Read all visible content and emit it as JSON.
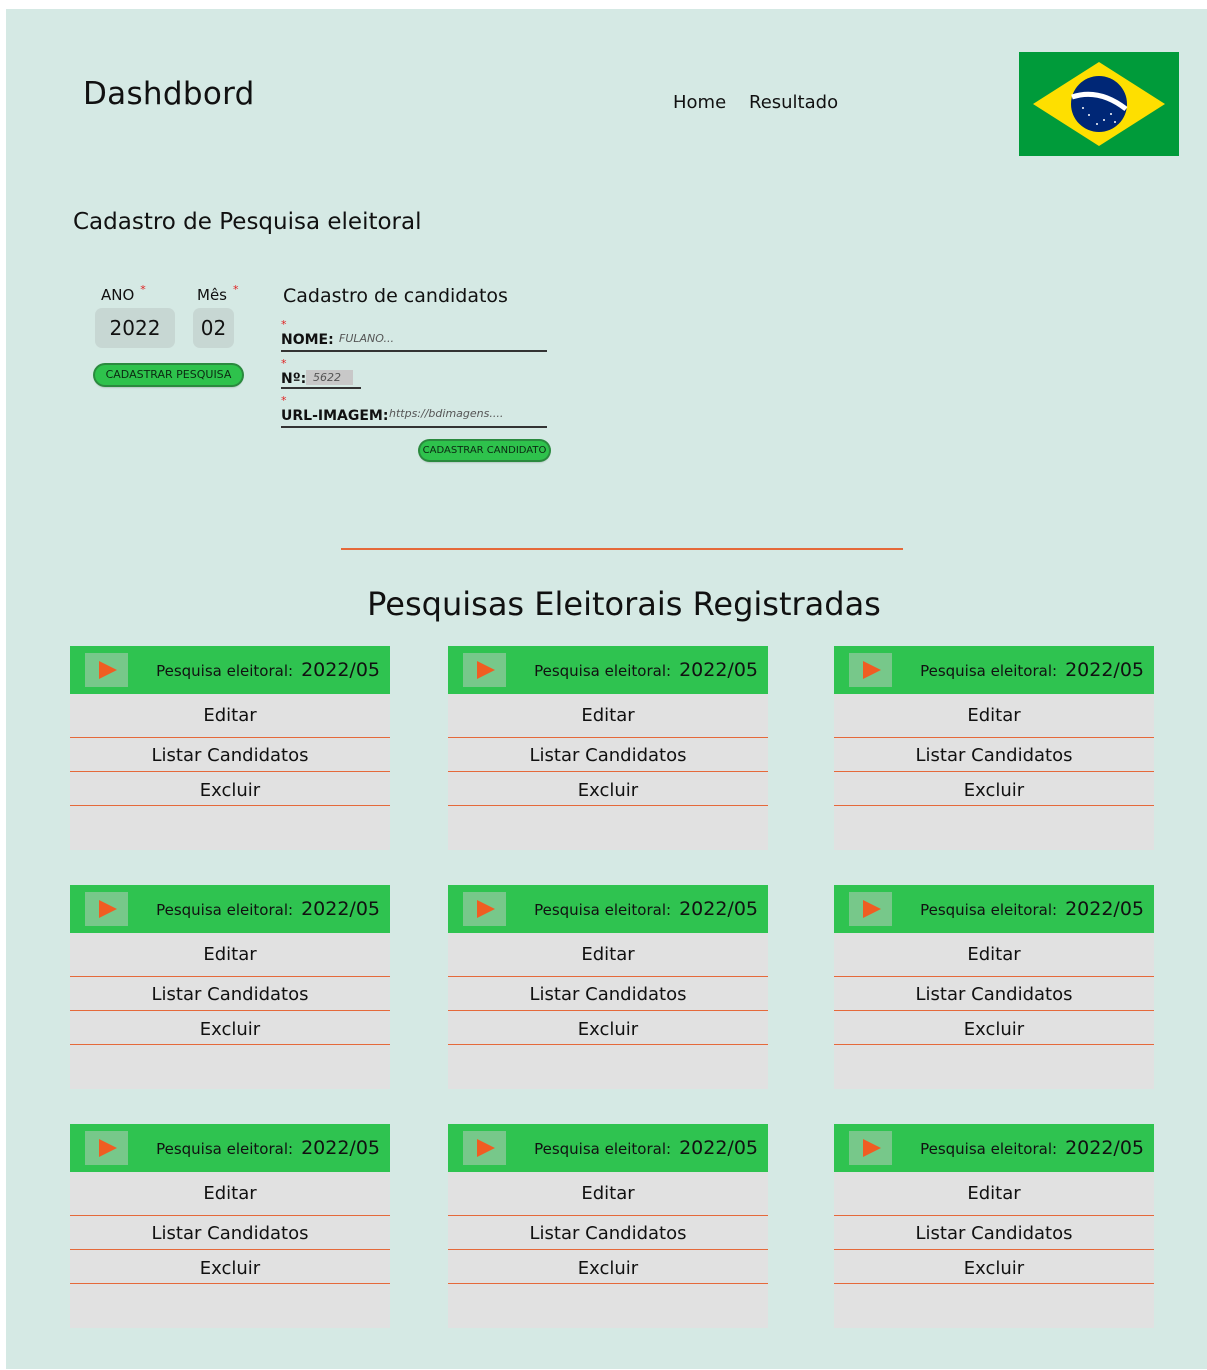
{
  "header": {
    "title": "Dashdbord",
    "nav": [
      "Home",
      "Resultado"
    ]
  },
  "form": {
    "title": "Cadastro de Pesquisa eleitoral",
    "ano_label": "ANO",
    "ano_value": "2022",
    "mes_label": "Mês",
    "mes_value": "02",
    "required_mark": "*",
    "submit_label": "CADASTRAR PESQUISA"
  },
  "candidate_form": {
    "title": "Cadastro de candidatos",
    "nome_label": "NOME:",
    "nome_placeholder": "FULANO...",
    "numero_label": "Nº:",
    "numero_value": "5622",
    "url_label": "URL-IMAGEM:",
    "url_placeholder": "https://bdimagens....",
    "submit_label": "CADASTRAR CANDIDATO"
  },
  "list": {
    "title": "Pesquisas Eleitorais Registradas",
    "cards": [
      {
        "label": "Pesquisa eleitoral:",
        "value": "2022/05",
        "actions": [
          "Editar",
          "Listar Candidatos",
          "Excluir"
        ]
      },
      {
        "label": "Pesquisa eleitoral:",
        "value": "2022/05",
        "actions": [
          "Editar",
          "Listar Candidatos",
          "Excluir"
        ]
      },
      {
        "label": "Pesquisa eleitoral:",
        "value": "2022/05",
        "actions": [
          "Editar",
          "Listar Candidatos",
          "Excluir"
        ]
      },
      {
        "label": "Pesquisa eleitoral:",
        "value": "2022/05",
        "actions": [
          "Editar",
          "Listar Candidatos",
          "Excluir"
        ]
      },
      {
        "label": "Pesquisa eleitoral:",
        "value": "2022/05",
        "actions": [
          "Editar",
          "Listar Candidatos",
          "Excluir"
        ]
      },
      {
        "label": "Pesquisa eleitoral:",
        "value": "2022/05",
        "actions": [
          "Editar",
          "Listar Candidatos",
          "Excluir"
        ]
      },
      {
        "label": "Pesquisa eleitoral:",
        "value": "2022/05",
        "actions": [
          "Editar",
          "Listar Candidatos",
          "Excluir"
        ]
      },
      {
        "label": "Pesquisa eleitoral:",
        "value": "2022/05",
        "actions": [
          "Editar",
          "Listar Candidatos",
          "Excluir"
        ]
      },
      {
        "label": "Pesquisa eleitoral:",
        "value": "2022/05",
        "actions": [
          "Editar",
          "Listar Candidatos",
          "Excluir"
        ]
      }
    ]
  },
  "colors": {
    "background": "#d5e9e4",
    "accent_green": "#2fc350",
    "divider_orange": "#e5693a",
    "play_orange": "#f05d22"
  },
  "icons": {
    "flag": "brazil-flag-icon",
    "play": "play-icon"
  }
}
